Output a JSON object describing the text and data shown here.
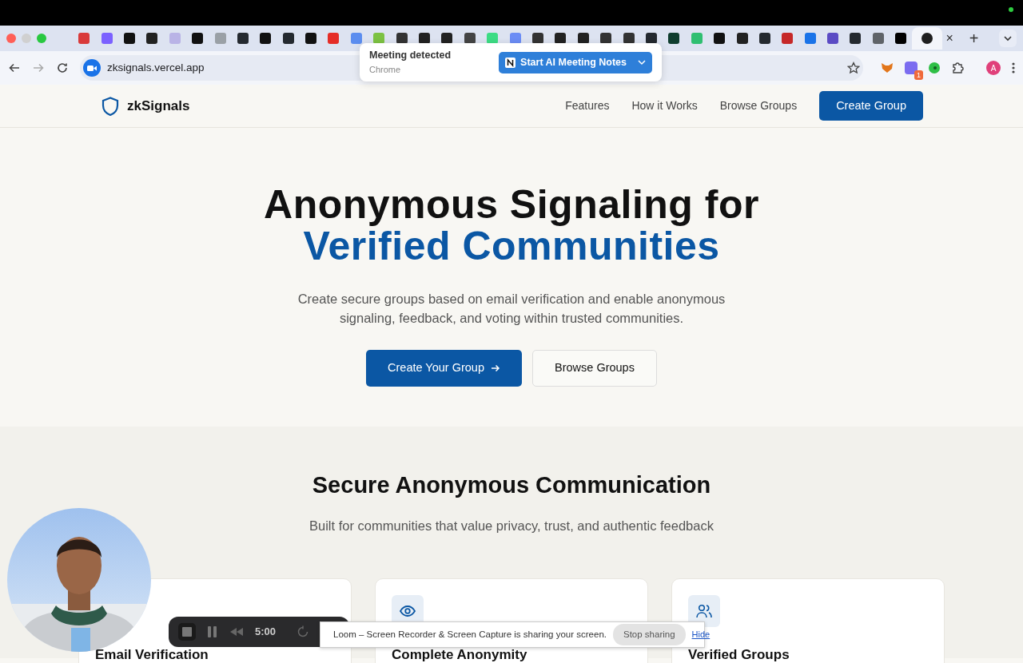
{
  "browser": {
    "tabs": [
      {
        "color": "#d93a3a",
        "selected": false
      },
      {
        "color": "#7b61ff",
        "selected": false
      },
      {
        "color": "#111111",
        "selected": false
      },
      {
        "color": "#222222",
        "selected": false
      },
      {
        "color": "#b9b3e6",
        "selected": false
      },
      {
        "color": "#111111",
        "selected": false
      },
      {
        "color": "#9aa0a6",
        "selected": false
      },
      {
        "color": "#24292f",
        "selected": false
      },
      {
        "color": "#111111",
        "selected": false
      },
      {
        "color": "#24292f",
        "selected": false
      },
      {
        "color": "#111111",
        "selected": false
      },
      {
        "color": "#e52d27",
        "selected": false
      },
      {
        "color": "#5b8def",
        "selected": false
      },
      {
        "color": "#7cc242",
        "selected": false
      },
      {
        "color": "#333333",
        "selected": false
      },
      {
        "color": "#222222",
        "selected": false
      },
      {
        "color": "#222222",
        "selected": false
      },
      {
        "color": "#444444",
        "selected": false
      },
      {
        "color": "#3ddc84",
        "selected": false
      },
      {
        "color": "#6b8cf5",
        "selected": false
      },
      {
        "color": "#333333",
        "selected": false
      },
      {
        "color": "#222222",
        "selected": false
      },
      {
        "color": "#222222",
        "selected": false
      },
      {
        "color": "#333333",
        "selected": false
      },
      {
        "color": "#333333",
        "selected": false
      },
      {
        "color": "#24292f",
        "selected": false
      },
      {
        "color": "#0f3d2e",
        "selected": false
      },
      {
        "color": "#2fbf71",
        "selected": false
      },
      {
        "color": "#111111",
        "selected": false
      },
      {
        "color": "#222222",
        "selected": false
      },
      {
        "color": "#24292f",
        "selected": false
      },
      {
        "color": "#c62828",
        "selected": false
      },
      {
        "color": "#1a73e8",
        "selected": false
      },
      {
        "color": "#5b4bc4",
        "selected": false
      },
      {
        "color": "#24292f",
        "selected": false
      },
      {
        "color": "#5f6368",
        "selected": false
      },
      {
        "color": "#000000",
        "selected": false
      },
      {
        "color": "#1f1f1f",
        "selected": true
      }
    ],
    "close_tab": "×",
    "new_tab": "+",
    "address": "zksignals.vercel.app",
    "extension_badge": "1",
    "profile": "A"
  },
  "meeting_popup": {
    "title": "Meeting detected",
    "subtitle": "Chrome",
    "button": "Start AI Meeting Notes"
  },
  "site": {
    "brand": "zkSignals",
    "nav_links": [
      "Features",
      "How it Works",
      "Browse Groups"
    ],
    "nav_button": "Create Group",
    "hero": {
      "title_line1": "Anonymous Signaling for",
      "title_line2": "Verified Communities",
      "subtitle": "Create secure groups based on email verification and enable anonymous signaling, feedback, and voting within trusted communities.",
      "primary_button": "Create Your Group",
      "secondary_button": "Browse Groups"
    },
    "features": {
      "title": "Secure Anonymous Communication",
      "subtitle": "Built for communities that value privacy, trust, and authentic feedback",
      "cards": [
        {
          "title": "Email Verification"
        },
        {
          "kind": "eye",
          "title": "Complete Anonymity"
        },
        {
          "kind": "users",
          "title": "Verified Groups"
        }
      ]
    }
  },
  "loom_controls": {
    "timer": "5:00"
  },
  "share_bar": {
    "message": "Loom – Screen Recorder & Screen Capture is sharing your screen.",
    "stop_button": "Stop sharing",
    "hide_link": "Hide"
  }
}
